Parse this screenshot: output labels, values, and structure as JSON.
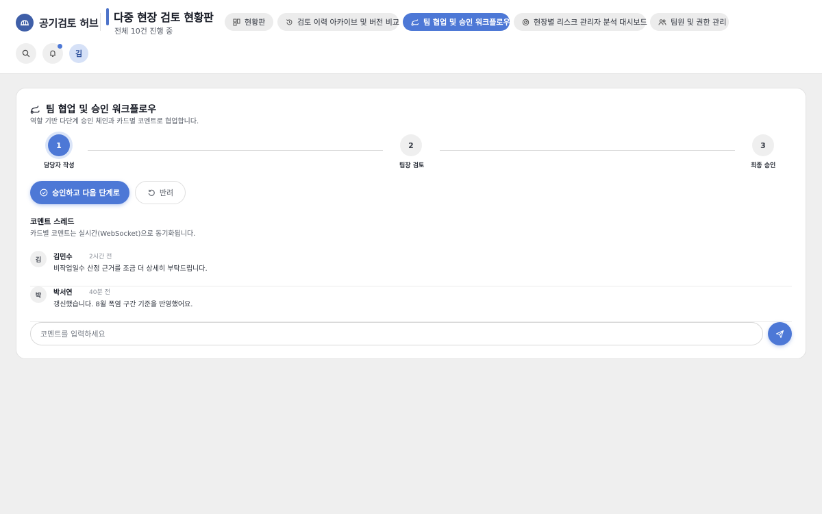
{
  "app": {
    "name": "공기검토 허브",
    "page_title": "다중 현장 검토 현황판",
    "page_subtitle": "전체 10건 진행 중"
  },
  "nav": {
    "tabs": [
      {
        "label": "현황판",
        "icon": "dashboard-icon",
        "active": false
      },
      {
        "label": "검토 이력 아카이브 및 버전 비교",
        "icon": "history-icon",
        "active": false
      },
      {
        "label": "팀 협업 및 승인 워크플로우",
        "icon": "workflow-icon",
        "active": true
      },
      {
        "label": "현장별 리스크 관리자 분석 대시보드",
        "icon": "radar-icon",
        "active": false
      },
      {
        "label": "팀원 및 권한 관리",
        "icon": "team-icon",
        "active": false
      }
    ]
  },
  "tools": {
    "avatar_initial": "김"
  },
  "workflow": {
    "title": "팀 협업 및 승인 워크플로우",
    "description": "역할 기반 다단계 승인 체인과 카드별 코멘트로 협업합니다.",
    "steps": [
      {
        "number": "1",
        "label": "담당자 작성",
        "status": "current"
      },
      {
        "number": "2",
        "label": "팀장 검토",
        "status": "pending"
      },
      {
        "number": "3",
        "label": "최종 승인",
        "status": "pending"
      }
    ],
    "approve_label": "승인하고 다음 단계로",
    "reject_label": "반려"
  },
  "comments": {
    "title": "코멘트 스레드",
    "description": "카드별 코멘트는 실시간(WebSocket)으로 동기화됩니다.",
    "items": [
      {
        "initial": "김",
        "author": "김민수",
        "time": "2시간 전",
        "text": "비작업일수 산정 근거를 조금 더 상세히 부탁드립니다."
      },
      {
        "initial": "박",
        "author": "박서연",
        "time": "40분 전",
        "text": "갱신했습니다. 8월 폭염 구간 기준을 반영했어요."
      }
    ],
    "input_placeholder": "코멘트를 입력하세요"
  },
  "colors": {
    "accent": "#4d78d6",
    "background": "#efefef",
    "card": "#ffffff"
  }
}
